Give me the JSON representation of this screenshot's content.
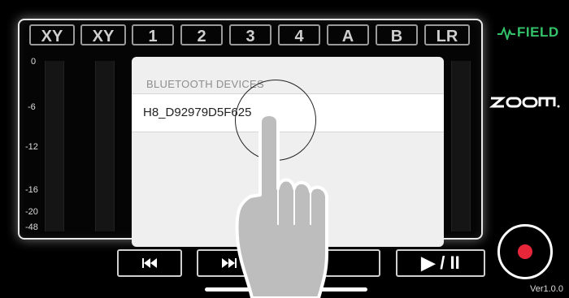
{
  "channels": [
    "XY",
    "XY",
    "1",
    "2",
    "3",
    "4",
    "A",
    "B",
    "LR"
  ],
  "scale": [
    "0",
    "-6",
    "-12",
    "-16",
    "-20",
    "-48"
  ],
  "brand": {
    "field": "FIELD",
    "maker": "ZOOM"
  },
  "modal": {
    "header": "BLUETOOTH DEVICES",
    "devices": [
      "H8_D92979D5F625"
    ]
  },
  "transport": {
    "play_pause": "▶ / II"
  },
  "version": "Ver1.0.0",
  "colors": {
    "record": "#e8263a",
    "field_accent": "#33c26a"
  }
}
